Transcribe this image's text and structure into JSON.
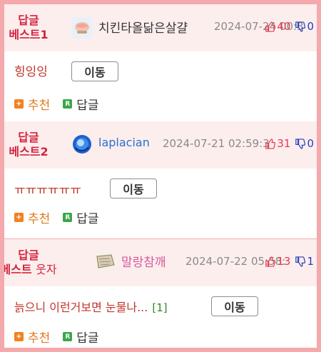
{
  "posts": [
    {
      "badge_line1": "답글",
      "badge_line2": "베스트1",
      "badge_suffix": "",
      "nickname": "치킨타올닮은살걀",
      "datetime": "2024-07-24 00:3",
      "up": "40",
      "down": "0",
      "title": "힝잉잉",
      "comment_count": "",
      "move_label": "이동",
      "recommend_label": "추천",
      "reply_label": "답글",
      "nick_color": "#333333"
    },
    {
      "badge_line1": "답글",
      "badge_line2": "베스트2",
      "badge_suffix": "",
      "nickname": "laplacian",
      "datetime": "2024-07-21 02:59:3",
      "up": "31",
      "down": "0",
      "title": "ㅠㅠㅠㅠㅠㅠ",
      "comment_count": "",
      "move_label": "이동",
      "recommend_label": "추천",
      "reply_label": "답글",
      "nick_color": "#2a6fc9"
    },
    {
      "badge_line1": "답글",
      "badge_line2": "베스트",
      "badge_suffix": "웃자",
      "nickname": "말랑참깨",
      "datetime": "2024-07-22 05:58:",
      "up": "13",
      "down": "1",
      "title": "늙으니 이런거보면 눈물나...",
      "comment_count": "[1]",
      "move_label": "이동",
      "recommend_label": "추천",
      "reply_label": "답글",
      "nick_color": "#d45a9a"
    }
  ],
  "icons": {
    "thumb_up": "thumbs-up-icon",
    "thumb_down": "thumbs-down-icon",
    "recommend": "plus-square-icon",
    "reply": "r-square-icon"
  },
  "colors": {
    "badge": "#d2243d",
    "up": "#e8394f",
    "down": "#2440b8",
    "recommend": "#e07818",
    "reply_icon": "#3aa64a",
    "title": "#c0352b",
    "header_bg": "#fdeeee",
    "border": "#f4a9ad"
  }
}
